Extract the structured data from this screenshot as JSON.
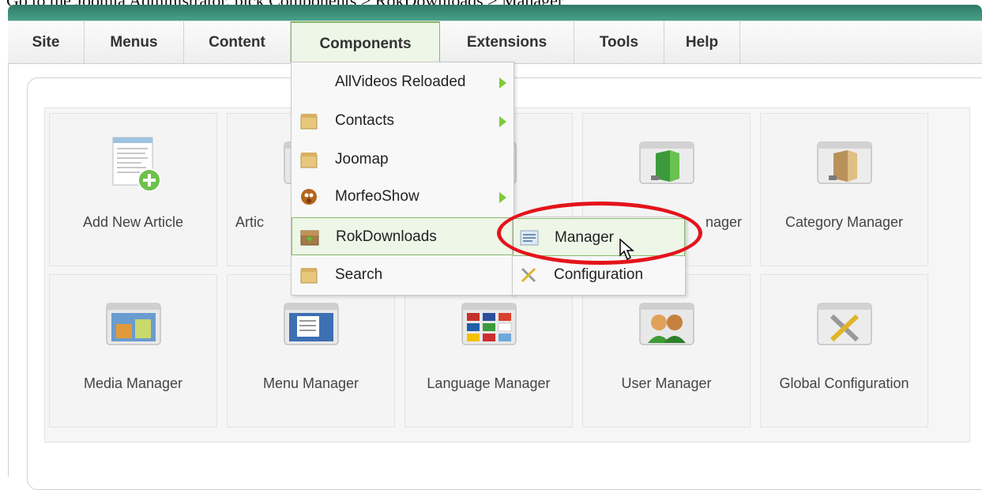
{
  "caption": "Go to the Joomla Administrator, pick Components > RokDownloads > Manager",
  "menubar": {
    "items": [
      {
        "label": "Site"
      },
      {
        "label": "Menus"
      },
      {
        "label": "Content"
      },
      {
        "label": "Components"
      },
      {
        "label": "Extensions"
      },
      {
        "label": "Tools"
      },
      {
        "label": "Help"
      }
    ]
  },
  "dropdown": {
    "items": [
      {
        "label": "AllVideos Reloaded",
        "icon": "none",
        "has_submenu": true
      },
      {
        "label": "Contacts",
        "icon": "package-icon",
        "has_submenu": true
      },
      {
        "label": "Joomap",
        "icon": "package-icon",
        "has_submenu": false
      },
      {
        "label": "MorfeoShow",
        "icon": "morfeo-icon",
        "has_submenu": true
      },
      {
        "label": "RokDownloads",
        "icon": "download-box-icon",
        "has_submenu": false
      },
      {
        "label": "Search",
        "icon": "package-icon",
        "has_submenu": false
      }
    ]
  },
  "submenu": {
    "items": [
      {
        "label": "Manager",
        "icon": "list-icon"
      },
      {
        "label": "Configuration",
        "icon": "tools-icon"
      }
    ]
  },
  "dashboard": {
    "tiles": [
      {
        "label": "Add New Article",
        "icon": "add-article-icon"
      },
      {
        "label": "Artic",
        "icon": "article-manager-icon"
      },
      {
        "label": "",
        "icon": "frontpage-icon"
      },
      {
        "label": "nager",
        "icon": "section-manager-icon"
      },
      {
        "label": "Category Manager",
        "icon": "category-manager-icon"
      },
      {
        "label": "Media Manager",
        "icon": "media-manager-icon"
      },
      {
        "label": "Menu Manager",
        "icon": "menu-manager-icon"
      },
      {
        "label": "Language Manager",
        "icon": "language-manager-icon"
      },
      {
        "label": "User Manager",
        "icon": "user-manager-icon"
      },
      {
        "label": "Global Configuration",
        "icon": "global-config-icon"
      }
    ]
  },
  "colors": {
    "header_band": "#47a189",
    "active_menu_bg": "#eef6e7",
    "active_border": "#87b86c",
    "highlight_ellipse": "#e5131b",
    "submenu_arrow": "#7ccb3a"
  }
}
